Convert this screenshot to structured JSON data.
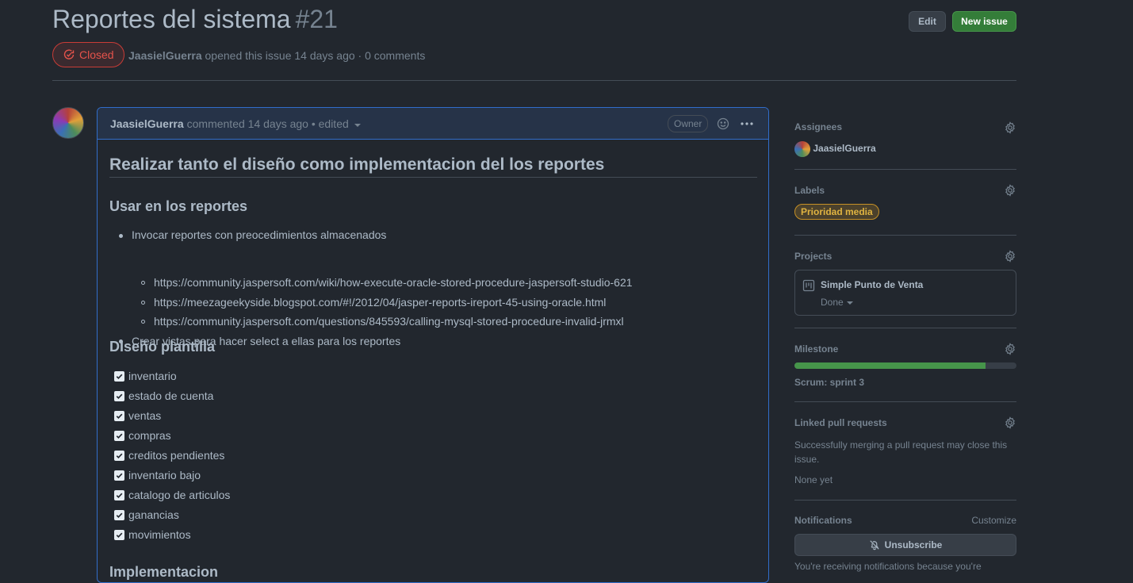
{
  "issue": {
    "title": "Reportes del sistema",
    "number": "#21",
    "status": "Closed",
    "author": "JaasielGuerra",
    "meta_text": "opened this issue 14 days ago · 0 comments"
  },
  "header_buttons": {
    "edit": "Edit",
    "new_issue": "New issue"
  },
  "comment": {
    "author": "JaasielGuerra",
    "meta": "commented 14 days ago • edited",
    "badge": "Owner",
    "heading": "Realizar tanto el diseño como implementacion del los reportes",
    "section1": {
      "title": "Usar en los reportes",
      "item1": "Invocar reportes con preocedimientos almacenados",
      "links": [
        "https://community.jaspersoft.com/wiki/how-execute-oracle-stored-procedure-jaspersoft-studio-621",
        "https://meezageekyside.blogspot.com/#!/2012/04/jasper-reports-ireport-45-using-oracle.html",
        "https://community.jaspersoft.com/questions/845593/calling-mysql-stored-procedure-invalid-jrmxl"
      ],
      "item2": "Crear vistas para hacer select a ellas para los reportes"
    },
    "section2": {
      "title": "DIseño plantilla",
      "tasks": [
        "inventario",
        "estado de cuenta",
        "ventas",
        "compras",
        "creditos pendientes",
        "inventario bajo",
        "catalogo de articulos",
        "ganancias",
        "movimientos"
      ]
    },
    "section3": {
      "title": "Implementacion"
    }
  },
  "sidebar": {
    "assignees": {
      "title": "Assignees",
      "user": "JaasielGuerra"
    },
    "labels": {
      "title": "Labels",
      "label": "Prioridad media"
    },
    "projects": {
      "title": "Projects",
      "name": "Simple Punto de Venta",
      "column": "Done"
    },
    "milestone": {
      "title": "Milestone",
      "name": "Scrum: sprint 3",
      "progress_percent": 86
    },
    "linked_prs": {
      "title": "Linked pull requests",
      "description": "Successfully merging a pull request may close this issue.",
      "value": "None yet"
    },
    "notifications": {
      "title": "Notifications",
      "customize": "Customize",
      "unsubscribe": "Unsubscribe",
      "reason": "You're receiving notifications because you're"
    }
  },
  "colors": {
    "closed": "#e5534b",
    "link": "#539bf5",
    "label": "#e0b341",
    "progress": "#46954a"
  }
}
